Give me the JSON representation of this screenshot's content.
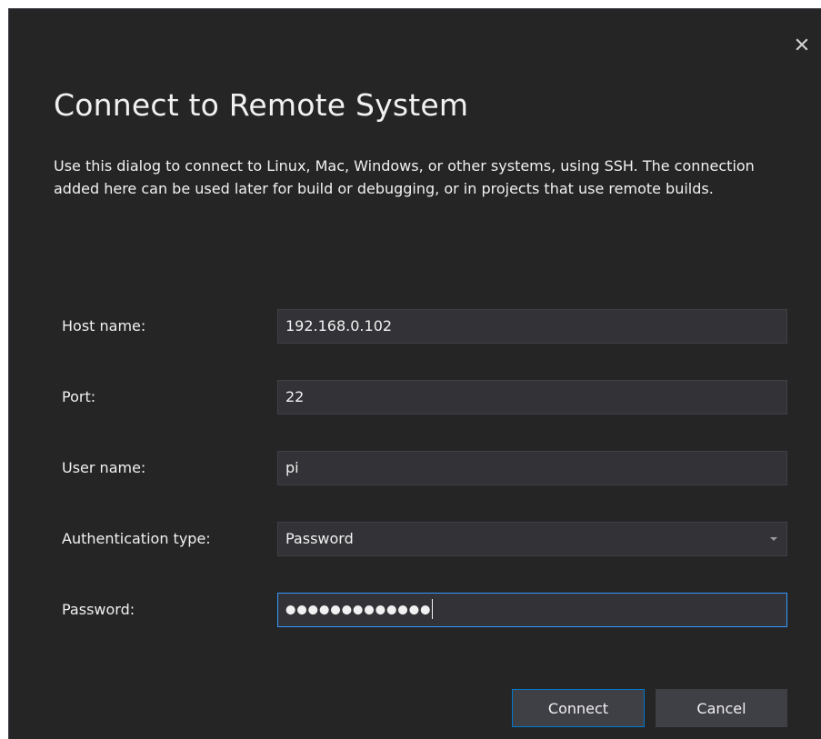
{
  "dialog": {
    "title": "Connect to Remote System",
    "description": "Use this dialog to connect to Linux, Mac, Windows, or other systems, using SSH. The connection added here can be used later for build or debugging, or in projects that use remote builds."
  },
  "form": {
    "host": {
      "label": "Host name:",
      "value": "192.168.0.102"
    },
    "port": {
      "label": "Port:",
      "value": "22"
    },
    "user": {
      "label": "User name:",
      "value": "pi"
    },
    "auth": {
      "label": "Authentication type:",
      "value": "Password"
    },
    "password": {
      "label": "Password:",
      "value": "●●●●●●●●●●●●●"
    }
  },
  "buttons": {
    "connect": "Connect",
    "cancel": "Cancel"
  },
  "icons": {
    "close": "close-icon",
    "dropdown": "chevron-down-icon"
  },
  "colors": {
    "background": "#252526",
    "input_background": "#333337",
    "border": "#3f3f46",
    "focus_border": "#3399ff",
    "primary_border": "#007acc",
    "text": "#f1f1f1"
  }
}
